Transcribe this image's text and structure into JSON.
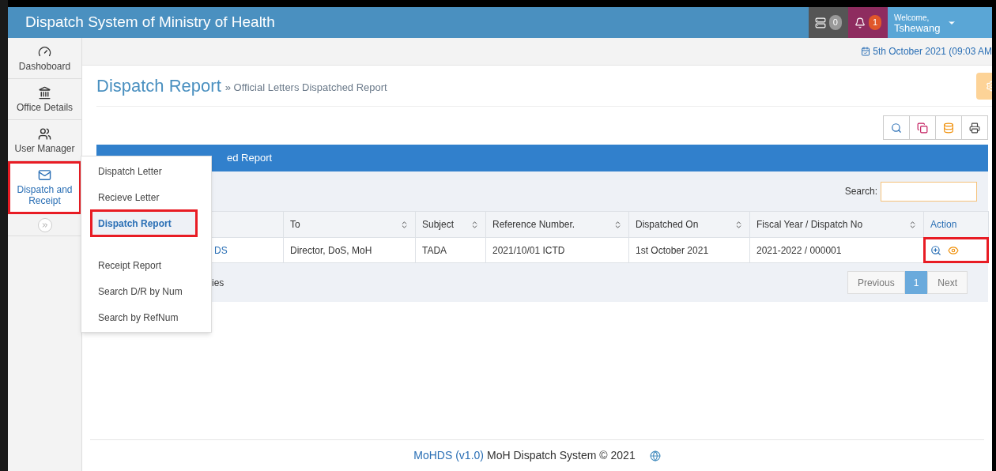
{
  "header": {
    "title": "Dispatch System of Ministry of Health",
    "notifications": [
      {
        "kind": "tasks",
        "count": "0"
      },
      {
        "kind": "alerts",
        "count": "1"
      }
    ],
    "user": {
      "greeting": "Welcome,",
      "name": "Tshewang"
    }
  },
  "sidebar": {
    "items": [
      {
        "kind": "dashboard",
        "label": "Dashoboard",
        "selected": false,
        "highlighted": false
      },
      {
        "kind": "bank",
        "label": "Office Details",
        "selected": false,
        "highlighted": false
      },
      {
        "kind": "users",
        "label": "User Manager",
        "selected": false,
        "highlighted": false
      },
      {
        "kind": "mail",
        "label": "Dispatch and Receipt",
        "selected": true,
        "highlighted": true
      }
    ]
  },
  "submenu": {
    "items": [
      {
        "label": "Dispatch Letter",
        "selected": false,
        "highlighted": false
      },
      {
        "label": "Recieve Letter",
        "selected": false,
        "highlighted": false
      },
      {
        "label": "Dispatch Report",
        "selected": true,
        "highlighted": true
      },
      {
        "label": "Receipt Report",
        "selected": false,
        "highlighted": false
      },
      {
        "label": "Search D/R by Num",
        "selected": false,
        "highlighted": false
      },
      {
        "label": "Search by RefNum",
        "selected": false,
        "highlighted": false
      }
    ]
  },
  "date": "5th October 2021 (09:03 AM",
  "page": {
    "title": "Dispatch Report",
    "breadcrumb": "» Official Letters Dispatched Report"
  },
  "toolbar": [
    {
      "kind": "search"
    },
    {
      "kind": "copy"
    },
    {
      "kind": "database"
    },
    {
      "kind": "print"
    }
  ],
  "panel": {
    "heading": "ed Report",
    "search_label": "Search:",
    "table": {
      "columns": [
        null,
        {
          "label": "To",
          "sortable": true
        },
        {
          "label": "Subject",
          "sortable": true
        },
        {
          "label": "Reference Number.",
          "sortable": true
        },
        {
          "label": "Dispatched On",
          "sortable": true
        },
        {
          "label": "Fiscal Year / Dispatch No",
          "sortable": true
        },
        {
          "label": "Action",
          "sortable": false
        }
      ],
      "rows": [
        {
          "cells": [
            "DS",
            "Director, DoS, MoH",
            "TADA",
            "2021/10/01 ICTD",
            "1st October 2021",
            "2021-2022 / 000001"
          ],
          "actions_highlighted": true
        }
      ]
    },
    "info": "ies",
    "pagination": {
      "previous": "Previous",
      "pages": [
        {
          "label": "1",
          "selected": true
        }
      ],
      "next": "Next"
    }
  },
  "footer": {
    "brand": "MoHDS (v1.0)",
    "text": "MoH Dispatch System © 2021"
  }
}
